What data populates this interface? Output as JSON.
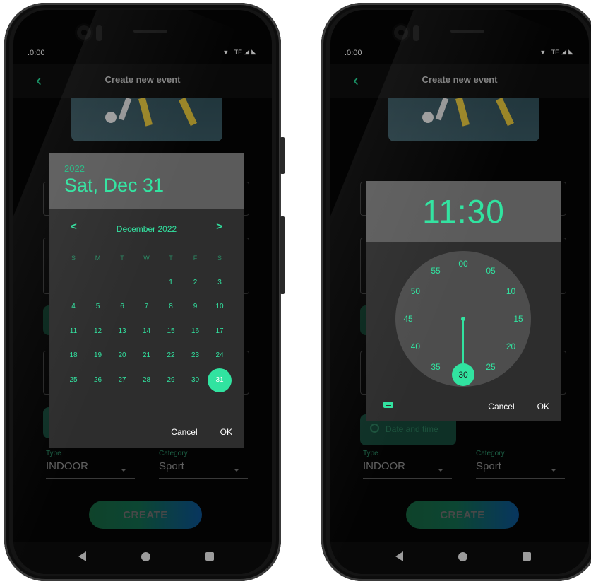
{
  "status": {
    "time": ".0:00",
    "network": "LTE"
  },
  "appbar": {
    "back": "‹",
    "title": "Create new event"
  },
  "form": {
    "type_label": "Type",
    "type_value": "INDOOR",
    "category_label": "Category",
    "category_value": "Sport",
    "create_label": "CREATE",
    "date_time_label": "Date and time"
  },
  "date_picker": {
    "year": "2022",
    "date": "Sat, Dec 31",
    "month": "December 2022",
    "weekdays": [
      "S",
      "M",
      "T",
      "W",
      "T",
      "F",
      "S"
    ],
    "days": [
      [
        "",
        "",
        "",
        "",
        "1",
        "2",
        "3"
      ],
      [
        "4",
        "5",
        "6",
        "7",
        "8",
        "9",
        "10"
      ],
      [
        "11",
        "12",
        "13",
        "14",
        "15",
        "16",
        "17"
      ],
      [
        "18",
        "19",
        "20",
        "21",
        "22",
        "23",
        "24"
      ],
      [
        "25",
        "26",
        "27",
        "28",
        "29",
        "30",
        "31"
      ]
    ],
    "selected": "31",
    "cancel": "Cancel",
    "ok": "OK"
  },
  "time_picker": {
    "time": "11:30",
    "minutes": [
      "00",
      "05",
      "10",
      "15",
      "20",
      "25",
      "30",
      "35",
      "40",
      "45",
      "50",
      "55"
    ],
    "selected": "30",
    "cancel": "Cancel",
    "ok": "OK"
  },
  "colors": {
    "accent": "#31e3a0",
    "dialog": "#2d2d2d",
    "header": "#5b5b5b"
  }
}
